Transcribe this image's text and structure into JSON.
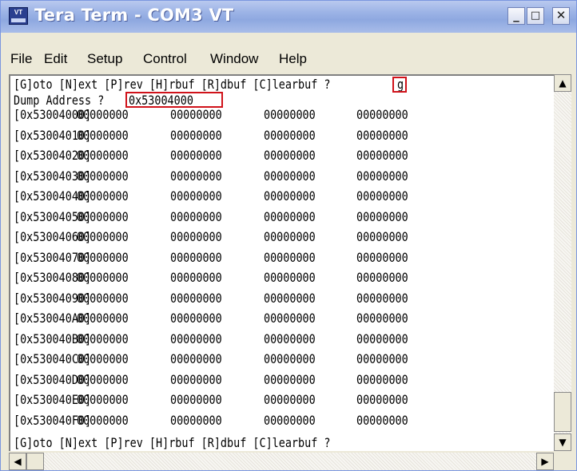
{
  "window": {
    "title": "Tera Term - COM3 VT",
    "app_icon_text": "VT",
    "minimize_glyph": "_",
    "maximize_glyph": "□",
    "close_glyph": "✕"
  },
  "menu": [
    "File",
    "Edit",
    "Setup",
    "Control",
    "Window",
    "Help"
  ],
  "terminal": {
    "prompt_line": "[G]oto [N]ext [P]rev [H]rbuf [R]dbuf [C]learbuf ?",
    "prompt_input": "g",
    "dump_label": "Dump Address ?",
    "dump_input": "0x53004000",
    "rows": [
      {
        "addr": "[0x53004000]",
        "values": [
          "00000000",
          "00000000",
          "00000000",
          "00000000"
        ]
      },
      {
        "addr": "[0x53004010]",
        "values": [
          "00000000",
          "00000000",
          "00000000",
          "00000000"
        ]
      },
      {
        "addr": "[0x53004020]",
        "values": [
          "00000000",
          "00000000",
          "00000000",
          "00000000"
        ]
      },
      {
        "addr": "[0x53004030]",
        "values": [
          "00000000",
          "00000000",
          "00000000",
          "00000000"
        ]
      },
      {
        "addr": "[0x53004040]",
        "values": [
          "00000000",
          "00000000",
          "00000000",
          "00000000"
        ]
      },
      {
        "addr": "[0x53004050]",
        "values": [
          "00000000",
          "00000000",
          "00000000",
          "00000000"
        ]
      },
      {
        "addr": "[0x53004060]",
        "values": [
          "00000000",
          "00000000",
          "00000000",
          "00000000"
        ]
      },
      {
        "addr": "[0x53004070]",
        "values": [
          "00000000",
          "00000000",
          "00000000",
          "00000000"
        ]
      },
      {
        "addr": "[0x53004080]",
        "values": [
          "00000000",
          "00000000",
          "00000000",
          "00000000"
        ]
      },
      {
        "addr": "[0x53004090]",
        "values": [
          "00000000",
          "00000000",
          "00000000",
          "00000000"
        ]
      },
      {
        "addr": "[0x530040A0]",
        "values": [
          "00000000",
          "00000000",
          "00000000",
          "00000000"
        ]
      },
      {
        "addr": "[0x530040B0]",
        "values": [
          "00000000",
          "00000000",
          "00000000",
          "00000000"
        ]
      },
      {
        "addr": "[0x530040C0]",
        "values": [
          "00000000",
          "00000000",
          "00000000",
          "00000000"
        ]
      },
      {
        "addr": "[0x530040D0]",
        "values": [
          "00000000",
          "00000000",
          "00000000",
          "00000000"
        ]
      },
      {
        "addr": "[0x530040E0]",
        "values": [
          "00000000",
          "00000000",
          "00000000",
          "00000000"
        ]
      },
      {
        "addr": "[0x530040F0]",
        "values": [
          "00000000",
          "00000000",
          "00000000",
          "00000000"
        ]
      }
    ],
    "final_prompt": "[G]oto [N]ext [P]rev [H]rbuf [R]dbuf [C]learbuf ?"
  },
  "scrollbars": {
    "up_glyph": "▲",
    "down_glyph": "▼",
    "left_glyph": "◀",
    "right_glyph": "▶"
  },
  "colors": {
    "highlight": "#d0121a"
  }
}
